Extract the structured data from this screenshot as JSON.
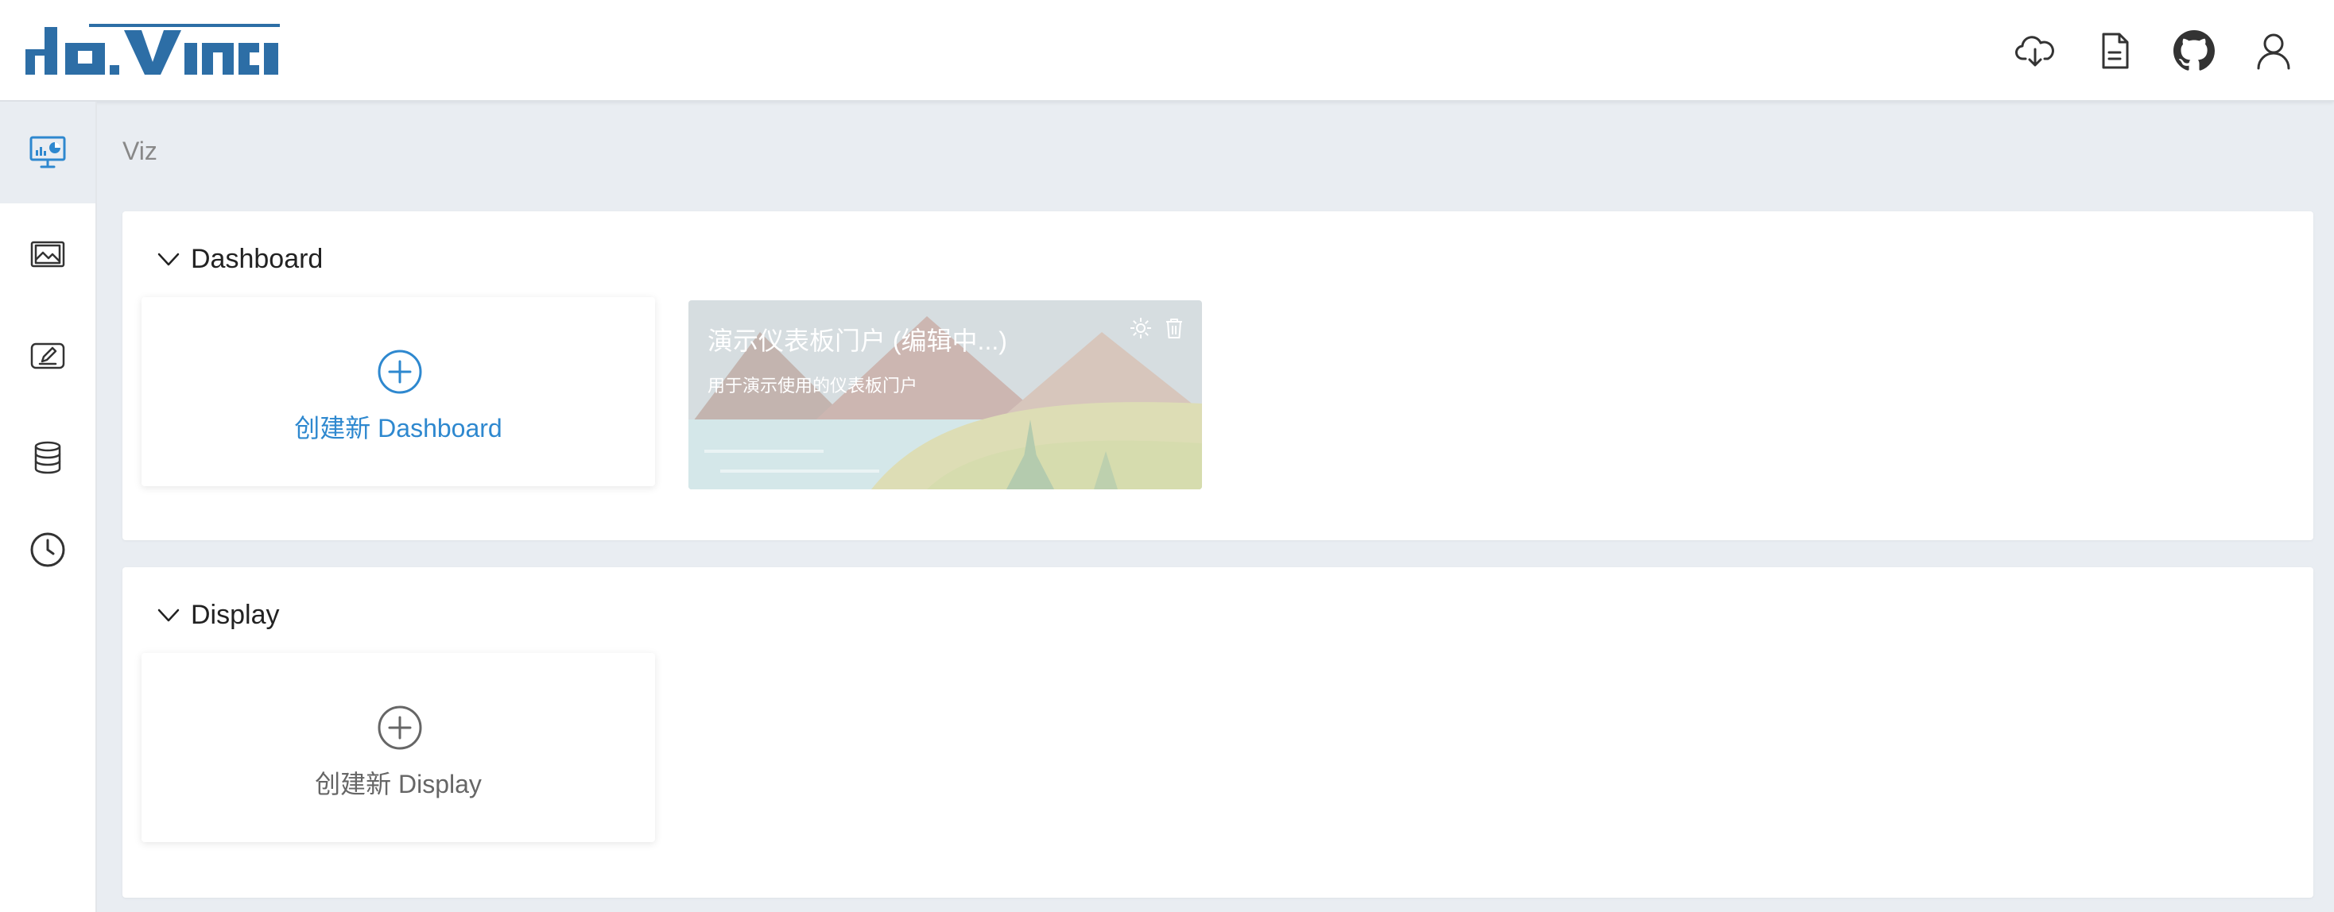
{
  "header": {
    "logo_text": "davinci",
    "icons": [
      "cloud-download-icon",
      "document-icon",
      "github-icon",
      "user-icon"
    ]
  },
  "sidebar": {
    "items": [
      {
        "icon": "monitor-chart-icon",
        "active": true
      },
      {
        "icon": "image-frame-icon",
        "active": false
      },
      {
        "icon": "edit-screen-icon",
        "active": false
      },
      {
        "icon": "database-icon",
        "active": false
      },
      {
        "icon": "clock-icon",
        "active": false
      }
    ]
  },
  "breadcrumb": "Viz",
  "dashboard_section": {
    "title": "Dashboard",
    "create_label": "创建新 Dashboard",
    "cards": [
      {
        "title": "演示仪表板门户 (编辑中...)",
        "description": "用于演示使用的仪表板门户"
      }
    ]
  },
  "display_section": {
    "title": "Display",
    "create_label": "创建新 Display"
  },
  "colors": {
    "accent": "#2e88cf",
    "logo": "#2d6ea6",
    "muted": "#888888",
    "background": "#e9edf2"
  }
}
